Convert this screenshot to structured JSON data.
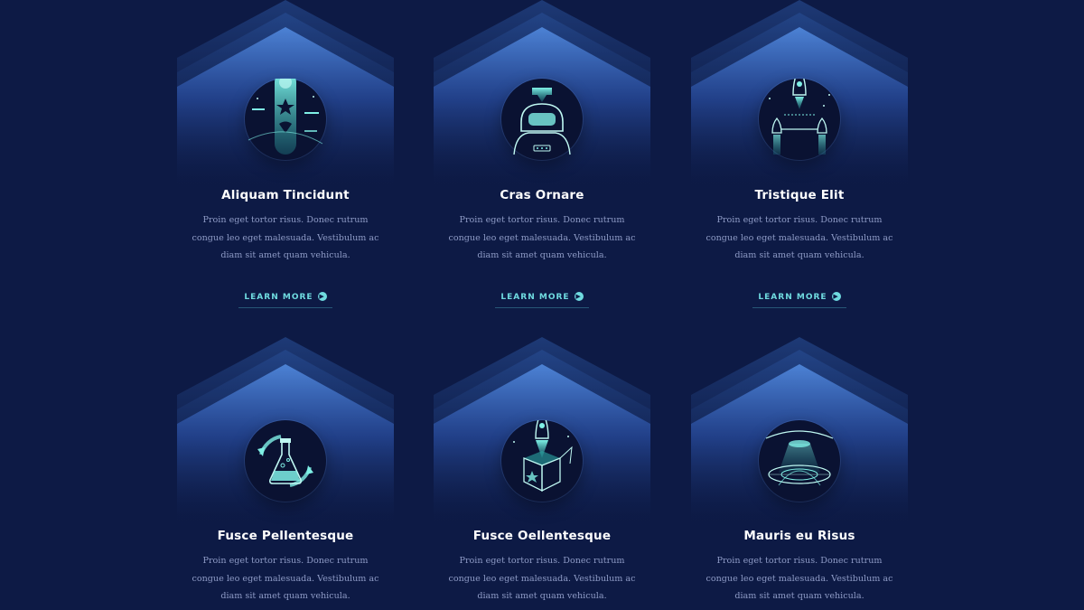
{
  "colors": {
    "background": "#0d1a45",
    "accent": "#6fdbe0",
    "title": "#ffffff",
    "body_text": "#8e9bc6"
  },
  "cards": [
    {
      "title": "Aliquam Tincidunt",
      "icon": "bookmark-stars-icon",
      "description": "Proin eget tortor risus. Donec rutrum\ncongue leo eget malesuada. Vestibulum ac\ndiam sit amet quam vehicula.",
      "link_label": "LEARN MORE"
    },
    {
      "title": "Cras Ornare",
      "icon": "astronaut-icon",
      "description": "Proin eget tortor risus. Donec rutrum\ncongue leo eget malesuada. Vestibulum ac\ndiam sit amet quam vehicula.",
      "link_label": "LEARN MORE"
    },
    {
      "title": "Tristique Elit",
      "icon": "rocket-fleet-icon",
      "description": "Proin eget tortor risus. Donec rutrum\ncongue leo eget malesuada. Vestibulum ac\ndiam sit amet quam vehicula.",
      "link_label": "LEARN MORE"
    },
    {
      "title": "Fusce Pellentesque",
      "icon": "flask-cycle-icon",
      "description": "Proin eget tortor risus. Donec rutrum\ncongue leo eget malesuada. Vestibulum ac\ndiam sit amet quam vehicula."
    },
    {
      "title": "Fusce Oellentesque",
      "icon": "rocket-box-icon",
      "description": "Proin eget tortor risus. Donec rutrum\ncongue leo eget malesuada. Vestibulum ac\ndiam sit amet quam vehicula."
    },
    {
      "title": "Mauris eu Risus",
      "icon": "ufo-beam-icon",
      "description": "Proin eget tortor risus. Donec rutrum\ncongue leo eget malesuada. Vestibulum ac\ndiam sit amet quam vehicula."
    }
  ]
}
